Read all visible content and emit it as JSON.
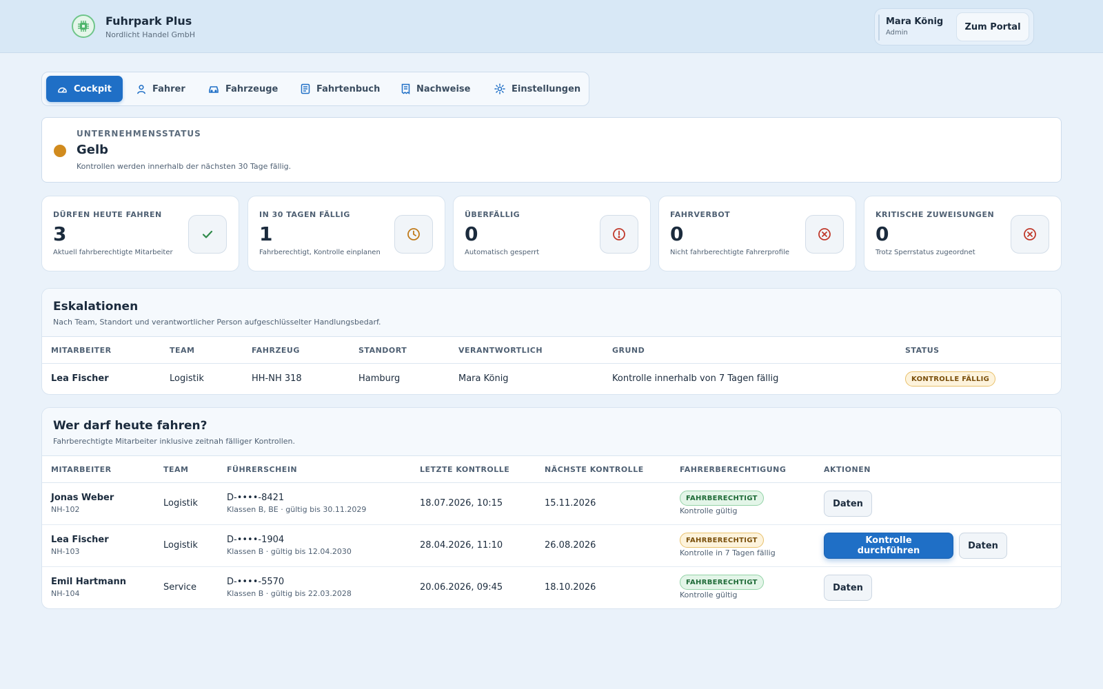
{
  "colors": {
    "accent": "#1f6fc6",
    "status_yellow": "#d18b1e",
    "ok_green": "#2f8a4a",
    "warn_orange": "#c07a1a",
    "danger_red": "#c0392b"
  },
  "header": {
    "app_title": "Fuhrpark Plus",
    "company": "Nordlicht Handel GmbH",
    "logo_icon": "steering-chip-icon",
    "user_name": "Mara König",
    "user_role": "Admin",
    "portal_button": "Zum Portal"
  },
  "nav": {
    "items": [
      {
        "label": "Cockpit",
        "icon": "speedometer-icon",
        "active": true
      },
      {
        "label": "Fahrer",
        "icon": "user-icon",
        "active": false
      },
      {
        "label": "Fahrzeuge",
        "icon": "car-icon",
        "active": false
      },
      {
        "label": "Fahrtenbuch",
        "icon": "logbook-icon",
        "active": false
      },
      {
        "label": "Nachweise",
        "icon": "document-icon",
        "active": false
      },
      {
        "label": "Einstellungen",
        "icon": "gear-icon",
        "active": false
      }
    ]
  },
  "company_status": {
    "label": "UNTERNEHMENSSTATUS",
    "value": "Gelb",
    "description": "Kontrollen werden innerhalb der nächsten 30 Tage fällig."
  },
  "kpis": [
    {
      "label": "DÜRFEN HEUTE FAHREN",
      "value": "3",
      "description": "Aktuell fahrberechtigte Mitarbeiter",
      "icon": "check-icon"
    },
    {
      "label": "IN 30 TAGEN FÄLLIG",
      "value": "1",
      "description": "Fahrberechtigt, Kontrolle einplanen",
      "icon": "clock-icon"
    },
    {
      "label": "ÜBERFÄLLIG",
      "value": "0",
      "description": "Automatisch gesperrt",
      "icon": "alert-icon"
    },
    {
      "label": "FAHRVERBOT",
      "value": "0",
      "description": "Nicht fahrberechtigte Fahrerprofile",
      "icon": "x-circle-icon"
    },
    {
      "label": "KRITISCHE ZUWEISUNGEN",
      "value": "0",
      "description": "Trotz Sperrstatus zugeordnet",
      "icon": "x-circle-icon"
    }
  ],
  "escalations": {
    "title": "Eskalationen",
    "subtitle": "Nach Team, Standort und verantwortlicher Person aufgeschlüsselter Handlungsbedarf.",
    "columns": [
      "MITARBEITER",
      "TEAM",
      "FAHRZEUG",
      "STANDORT",
      "VERANTWORTLICH",
      "GRUND",
      "STATUS"
    ],
    "rows": [
      {
        "employee": "Lea Fischer",
        "team": "Logistik",
        "vehicle": "HH-NH 318",
        "location": "Hamburg",
        "responsible": "Mara König",
        "reason": "Kontrolle innerhalb von 7 Tagen fällig",
        "status": "KONTROLLE FÄLLIG"
      }
    ]
  },
  "drivers": {
    "title": "Wer darf heute fahren?",
    "subtitle": "Fahrberechtigte Mitarbeiter inklusive zeitnah fälliger Kontrollen.",
    "columns": [
      "MITARBEITER",
      "TEAM",
      "FÜHRERSCHEIN",
      "LETZTE KONTROLLE",
      "NÄCHSTE KONTROLLE",
      "FAHRERBERECHTIGUNG",
      "AKTIONEN"
    ],
    "rows": [
      {
        "name": "Jonas Weber",
        "id": "NH-102",
        "team": "Logistik",
        "license": "D-••••-8421",
        "license_detail": "Klassen B, BE · gültig bis 30.11.2029",
        "last_check": "18.07.2026, 10:15",
        "next_check": "15.11.2026",
        "permission": "FAHRBERECHTIGT",
        "permission_note": "Kontrolle gültig",
        "permission_style": "ok",
        "primary_action": "",
        "secondary_action": "Daten"
      },
      {
        "name": "Lea Fischer",
        "id": "NH-103",
        "team": "Logistik",
        "license": "D-••••-1904",
        "license_detail": "Klassen B · gültig bis 12.04.2030",
        "last_check": "28.04.2026, 11:10",
        "next_check": "26.08.2026",
        "permission": "FAHRBERECHTIGT",
        "permission_note": "Kontrolle in 7 Tagen fällig",
        "permission_style": "warn",
        "primary_action": "Kontrolle durchführen",
        "secondary_action": "Daten"
      },
      {
        "name": "Emil Hartmann",
        "id": "NH-104",
        "team": "Service",
        "license": "D-••••-5570",
        "license_detail": "Klassen B · gültig bis 22.03.2028",
        "last_check": "20.06.2026, 09:45",
        "next_check": "18.10.2026",
        "permission": "FAHRBERECHTIGT",
        "permission_note": "Kontrolle gültig",
        "permission_style": "ok",
        "primary_action": "",
        "secondary_action": "Daten"
      }
    ]
  }
}
